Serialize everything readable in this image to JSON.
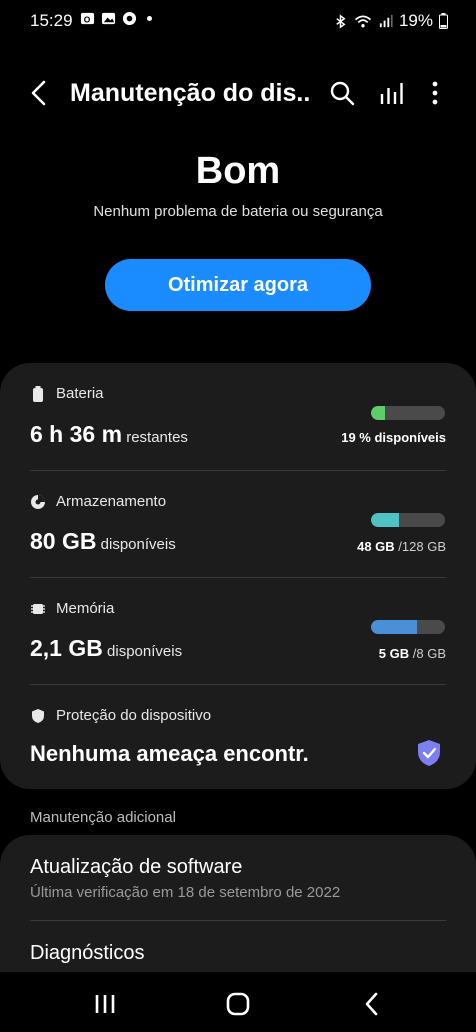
{
  "status_bar": {
    "time": "15:29",
    "battery_percent": "19%"
  },
  "app_bar": {
    "title": "Manutenção do dis...",
    "icons": [
      "back-icon",
      "search-icon",
      "bar-chart-icon",
      "more-vert-icon"
    ]
  },
  "hero": {
    "status": "Bom",
    "subtitle": "Nenhum problema de bateria ou segurança",
    "optimize_label": "Otimizar agora",
    "accent": "#1a8cff"
  },
  "items": {
    "battery": {
      "label": "Bateria",
      "value_big": "6 h 36 m",
      "value_small": " restantes",
      "level": 0.19,
      "bar_color": "#5ccf6a",
      "bar_bold": "19 % disponíveis",
      "bar_rest": ""
    },
    "storage": {
      "label": "Armazenamento",
      "value_big": "80 GB",
      "value_small": " disponíveis",
      "level": 0.375,
      "bar_color": "#4fc3c3",
      "bar_bold": "48 GB",
      "bar_rest": " /128 GB"
    },
    "memory": {
      "label": "Memória",
      "value_big": "2,1 GB",
      "value_small": " disponíveis",
      "level": 0.625,
      "bar_color": "#4a90d9",
      "bar_bold": "5 GB",
      "bar_rest": " /8 GB"
    },
    "protection": {
      "label": "Proteção do dispositivo",
      "value": "Nenhuma ameaça encontr.",
      "shield_color": "#7b7ff0"
    }
  },
  "additional": {
    "header": "Manutenção adicional",
    "software_update_title": "Atualização de software",
    "software_update_sub": "Última verificação em 18 de setembro de 2022",
    "diagnostics_title": "Diagnósticos"
  },
  "nav_bar": {
    "buttons": [
      "recents-icon",
      "home-icon",
      "back-nav-icon"
    ]
  }
}
